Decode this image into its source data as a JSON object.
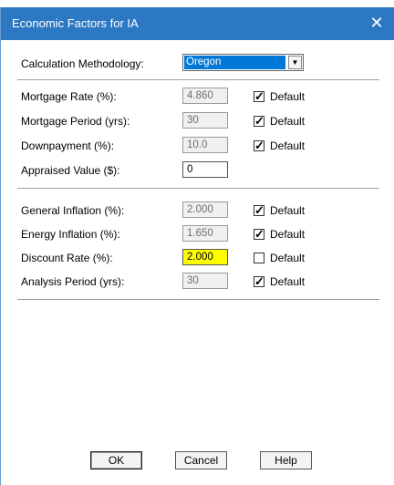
{
  "dialog": {
    "title": "Economic Factors for IA",
    "close_label": "✕"
  },
  "methodology": {
    "label": "Calculation Methodology:",
    "selected": "Oregon",
    "arrow": "▼"
  },
  "group1": [
    {
      "label": "Mortgage Rate (%):",
      "value": "4.860",
      "default_label": "Default",
      "default_checked": true,
      "editable": false
    },
    {
      "label": "Mortgage Period (yrs):",
      "value": "30",
      "default_label": "Default",
      "default_checked": true,
      "editable": false
    },
    {
      "label": "Downpayment (%):",
      "value": "10.0",
      "default_label": "Default",
      "default_checked": true,
      "editable": false
    },
    {
      "label": "Appraised Value ($):",
      "value": "0"
    }
  ],
  "group2": [
    {
      "label": "General Inflation (%):",
      "value": "2.000",
      "default_label": "Default",
      "default_checked": true,
      "editable": false
    },
    {
      "label": "Energy Inflation (%):",
      "value": "1.650",
      "default_label": "Default",
      "default_checked": true,
      "editable": false
    },
    {
      "label": "Discount Rate (%):",
      "value": "2.000",
      "default_label": "Default",
      "default_checked": false,
      "editable": true
    },
    {
      "label": "Analysis Period (yrs):",
      "value": "30",
      "default_label": "Default",
      "default_checked": true,
      "editable": false
    }
  ],
  "buttons": {
    "ok": "OK",
    "cancel": "Cancel",
    "help": "Help"
  },
  "colors": {
    "titlebar": "#2d78c2",
    "selection": "#0078d7",
    "highlight": "#fefe00"
  }
}
